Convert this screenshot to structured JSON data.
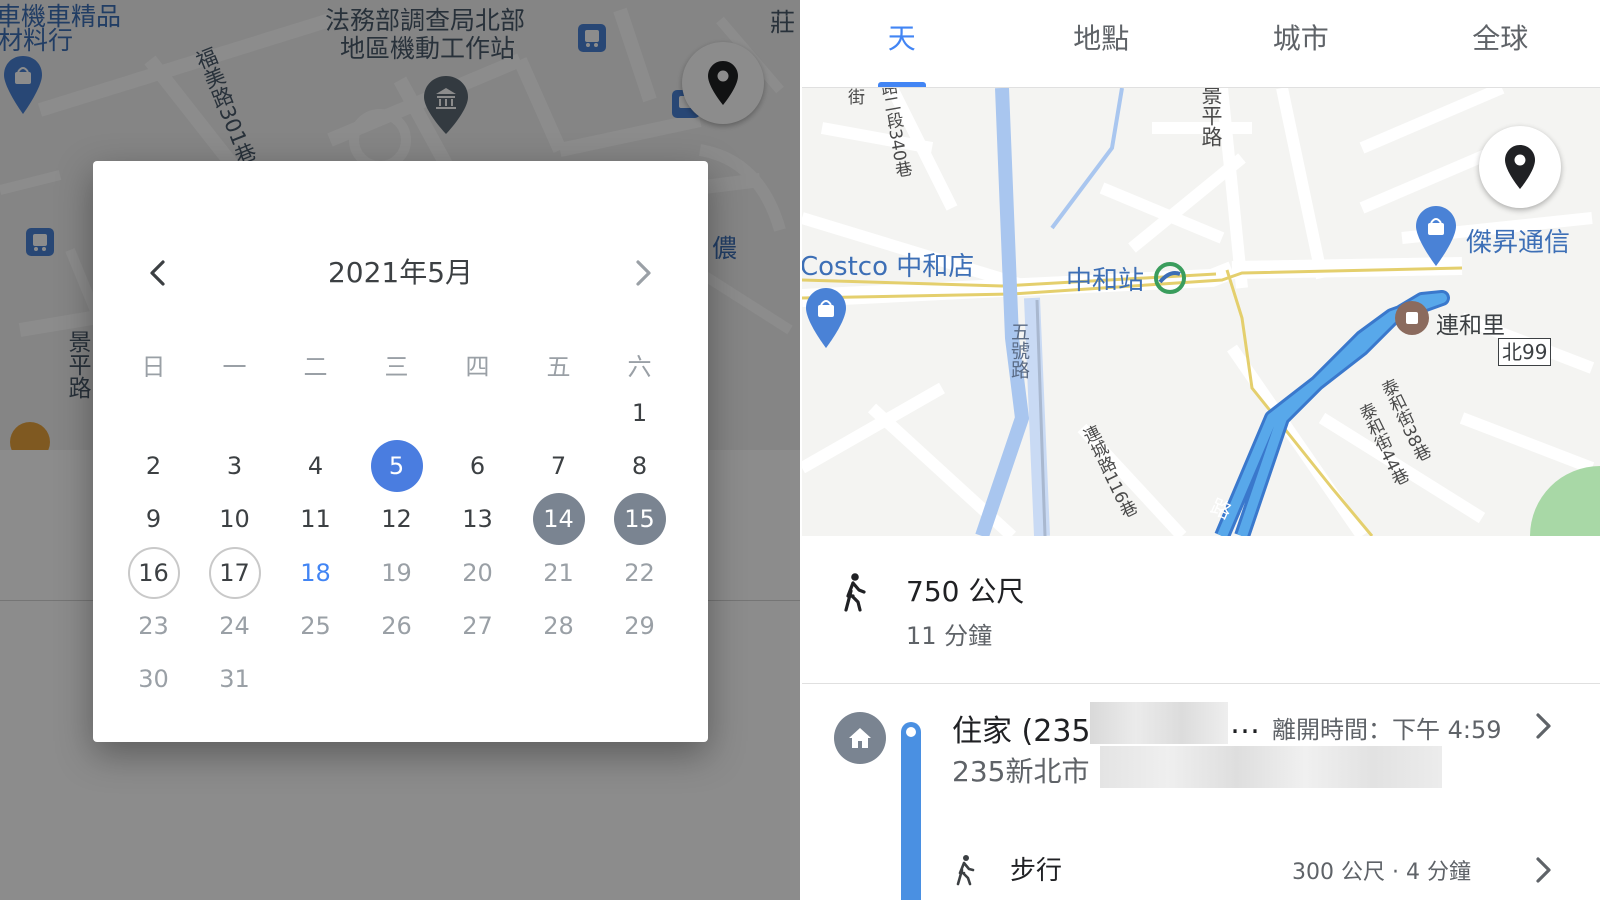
{
  "left_map": {
    "labels": {
      "shop_top": "車機車精品",
      "shop_sub": "材料行",
      "office_line1": "法務部調查局北部",
      "office_line2": "地區機動工作站",
      "road_fumei": "福美路301巷",
      "road_jingping": "景平路",
      "partial_right_top": "莊",
      "partial_right_mid": "儂"
    }
  },
  "calendar": {
    "title": "2021年5月",
    "weekdays": [
      "日",
      "一",
      "二",
      "三",
      "四",
      "五",
      "六"
    ],
    "days": [
      "1",
      "2",
      "3",
      "4",
      "5",
      "6",
      "7",
      "8",
      "9",
      "10",
      "11",
      "12",
      "13",
      "14",
      "15",
      "16",
      "17",
      "18",
      "19",
      "20",
      "21",
      "22",
      "23",
      "24",
      "25",
      "26",
      "27",
      "28",
      "29",
      "30",
      "31"
    ]
  },
  "tabs": [
    "天",
    "地點",
    "城市",
    "全球"
  ],
  "right_map": {
    "labels": {
      "costco": "Costco 中和店",
      "station": "中和站",
      "store": "傑昇通信",
      "lianhe": "連和里",
      "route_badge": "北99",
      "road_340": "路二段340巷",
      "road_ping": "景平路",
      "road_jie": "街",
      "road_116": "連城路116巷",
      "road_38": "泰和街38巷",
      "road_44": "泰和街44巷",
      "road_wuyi": "五號路",
      "road_bottom": "路"
    }
  },
  "route_summary": {
    "distance": "750 公尺",
    "duration": "11 分鐘"
  },
  "steps": {
    "home_name": "住家 (235",
    "ellipsis": "…",
    "depart_time": "離開時間：下午 4:59",
    "home_address": "235新北市",
    "walk_label": "步行",
    "walk_meta": "300 公尺 · 4 分鐘"
  },
  "colors": {
    "accent_blue": "#4285f4",
    "route_blue": "#4a90e2",
    "highlight_gray": "#7a8491"
  },
  "icons": [
    "chevron-left-icon",
    "chevron-right-icon",
    "map-pin-icon",
    "walk-icon",
    "home-icon",
    "shopping-bag-icon",
    "bus-icon",
    "museum-icon",
    "train-icon"
  ]
}
